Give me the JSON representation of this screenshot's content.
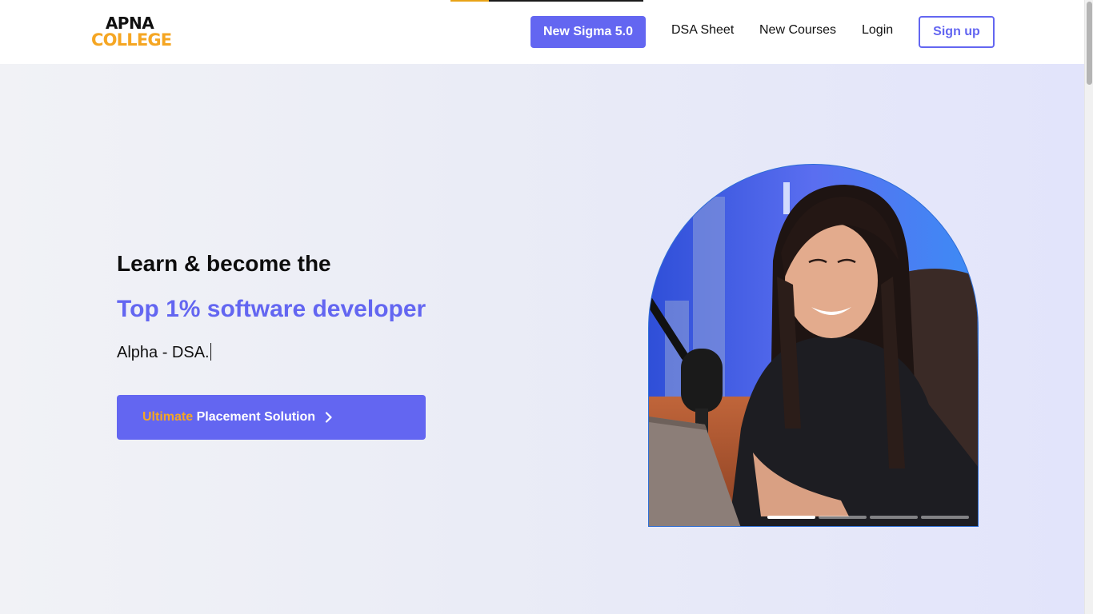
{
  "header": {
    "logo_line1": "APNA",
    "logo_line2": "COLLEGE",
    "nav": {
      "sigma_label": "New Sigma 5.0",
      "dsa_sheet_label": "DSA Sheet",
      "new_courses_label": "New Courses",
      "login_label": "Login",
      "signup_label": "Sign up"
    },
    "top_progress_fraction": 0.2
  },
  "hero": {
    "title": "Learn & become the",
    "highlight": "Top 1% software developer",
    "typed_text": "Alpha - DSA.",
    "cta": {
      "accent_label": "Ultimate",
      "label": "Placement Solution",
      "icon": "chevron-right-icon"
    },
    "image_slide_dots": 4,
    "active_slide": 1
  },
  "colors": {
    "brand_primary": "#6366f1",
    "brand_accent": "#f5a623",
    "text_dark": "#111111",
    "hero_bg_start": "#f1f2f6",
    "hero_bg_end": "#e2e4fb"
  }
}
